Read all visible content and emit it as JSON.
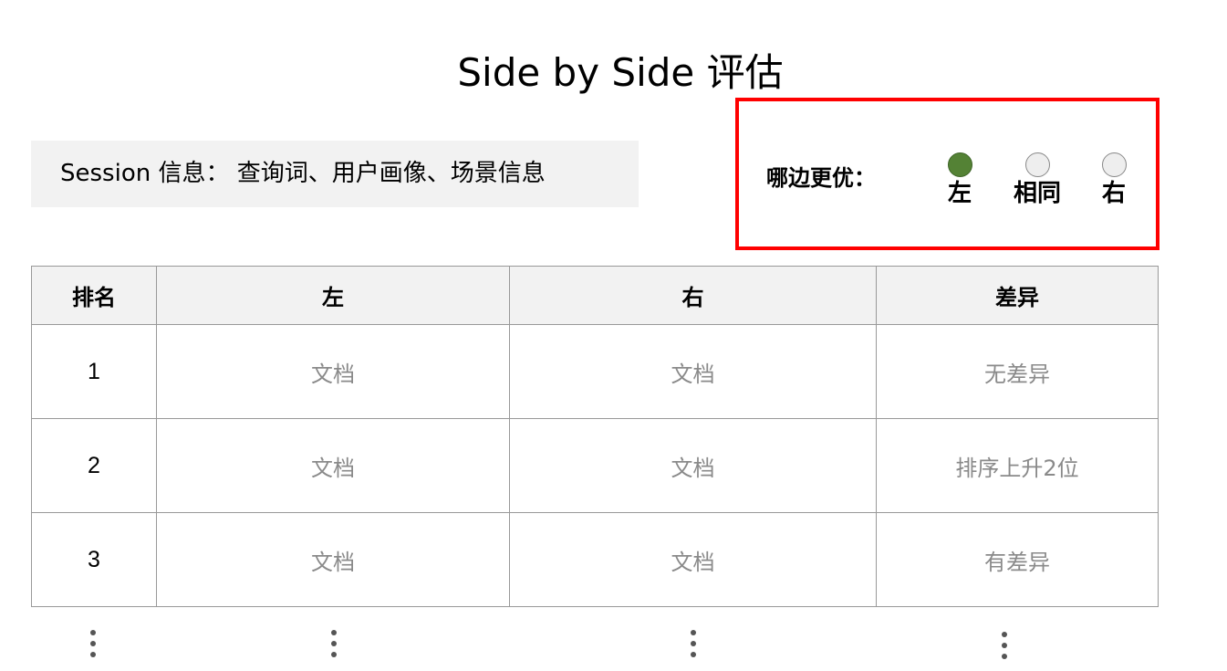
{
  "title": "Side by Side 评估",
  "session": {
    "text": "Session 信息： 查询词、用户画像、场景信息"
  },
  "vote": {
    "label": "哪边更优：",
    "options": [
      {
        "label": "左",
        "selected": true
      },
      {
        "label": "相同",
        "selected": false
      },
      {
        "label": "右",
        "selected": false
      }
    ],
    "selected_color": "#548235",
    "border_color": "#ff0000"
  },
  "table": {
    "headers": [
      "排名",
      "左",
      "右",
      "差异"
    ],
    "rows": [
      {
        "rank": "1",
        "left": "文档",
        "right": "文档",
        "diff": "无差异"
      },
      {
        "rank": "2",
        "left": "文档",
        "right": "文档",
        "diff": "排序上升2位"
      },
      {
        "rank": "3",
        "left": "文档",
        "right": "文档",
        "diff": "有差异"
      }
    ]
  },
  "continuation": "vertical-ellipsis-icon"
}
